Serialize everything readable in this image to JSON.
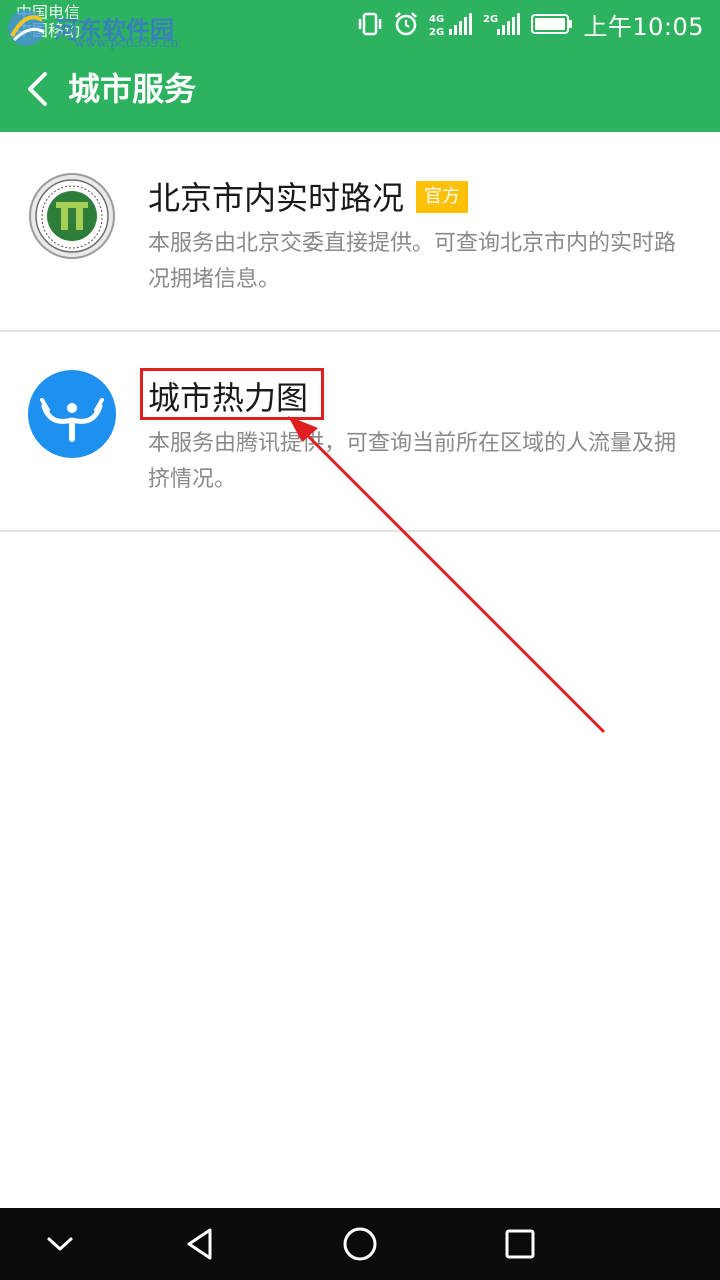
{
  "status_bar": {
    "carrier_line1": "中国电信",
    "carrier_line2": "中国移动",
    "network1": "4G",
    "network1b": "2G",
    "network2": "2G",
    "time": "上午10:05"
  },
  "watermark": {
    "text": "河东软件园",
    "url": "www.pc0359.cn"
  },
  "header": {
    "title": "城市服务"
  },
  "services": [
    {
      "title": "北京市内实时路况",
      "badge": "官方",
      "description": "本服务由北京交委直接提供。可查询北京市内的实时路况拥堵信息。",
      "icon": "beijing-transport-commission-logo"
    },
    {
      "title": "城市热力图",
      "description": "本服务由腾讯提供，可查询当前所在区域的人流量及拥挤情况。",
      "icon": "heatmap-person-logo"
    }
  ],
  "colors": {
    "primary_green": "#2db360",
    "badge_yellow": "#ffc107",
    "annotation_red": "#e02020",
    "heatmap_blue": "#1e90f0"
  },
  "nav": {
    "icons": [
      "chevron-down-icon",
      "back-triangle-icon",
      "home-circle-icon",
      "recent-square-icon"
    ]
  }
}
